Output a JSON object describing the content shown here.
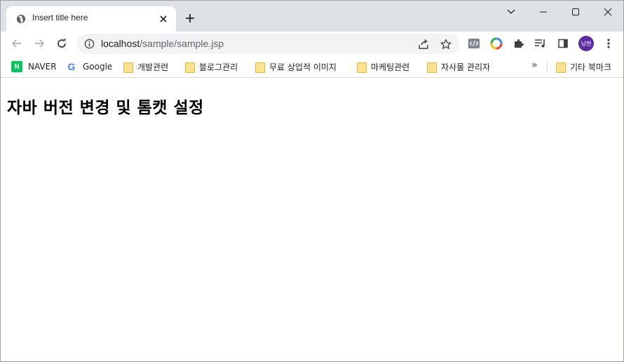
{
  "tab": {
    "title": "Insert title here"
  },
  "address_bar": {
    "host": "localhost",
    "path": "/sample/sample.jsp"
  },
  "profile": {
    "initials": "남현"
  },
  "bookmarks": {
    "items": [
      {
        "label": "NAVER",
        "icon": "naver-icon"
      },
      {
        "label": "Google",
        "icon": "google-icon"
      },
      {
        "label": "개발관련",
        "icon": "folder-icon"
      },
      {
        "label": "블로그관리",
        "icon": "folder-icon"
      },
      {
        "label": "무료 상업적 이미지",
        "icon": "folder-icon"
      },
      {
        "label": "마케팅관련",
        "icon": "folder-icon"
      },
      {
        "label": "자사몰 관리자",
        "icon": "folder-icon"
      }
    ],
    "overflow": "»",
    "other": "기타 북마크"
  },
  "page": {
    "heading": "자바 버전 변경 및 톰캣 설정"
  },
  "colors": {
    "tabstrip": "#dee1e6",
    "omnibox": "#f1f3f4",
    "avatar": "#5b2ca0",
    "folder": "#fde293"
  }
}
